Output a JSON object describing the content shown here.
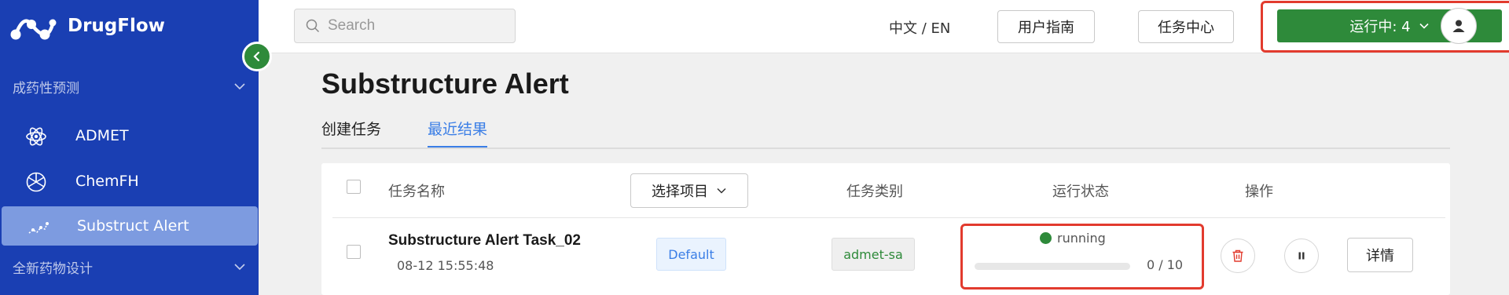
{
  "brand": {
    "name": "DrugFlow",
    "logo_icon": "drugflow-logo-icon"
  },
  "sidebar": {
    "groups": [
      {
        "label": "成药性预测",
        "expanded": true
      },
      {
        "label": "全新药物设计",
        "expanded": false
      }
    ],
    "items": [
      {
        "label": "ADMET",
        "icon": "atom-icon",
        "active": false
      },
      {
        "label": "ChemFH",
        "icon": "filter-wheel-icon",
        "active": false
      },
      {
        "label": "Substruct Alert",
        "icon": "substructure-icon",
        "active": true
      }
    ],
    "collapse_icon": "chevron-left-icon"
  },
  "topbar": {
    "search": {
      "placeholder": "Search",
      "value": ""
    },
    "lang_toggle": "中文 / EN",
    "user_guide": "用户指南",
    "task_center": "任务中心",
    "running_button": "运行中: 4",
    "highlight_color": "#e23b2e"
  },
  "main": {
    "title": "Substructure Alert",
    "tabs": [
      {
        "label": "创建任务",
        "active": false
      },
      {
        "label": "最近结果",
        "active": true
      }
    ],
    "table": {
      "headers": {
        "task_name": "任务名称",
        "select_project": "选择项目",
        "task_type": "任务类别",
        "status": "运行状态",
        "actions": "操作"
      },
      "rows": [
        {
          "name": "Substructure Alert Task_02",
          "time": "08-12 15:55:48",
          "project": "Default",
          "type": "admet-sa",
          "status": "running",
          "progress_done": 0,
          "progress_total": 10,
          "progress_text": "0 / 10",
          "detail_label": "详情"
        }
      ]
    }
  },
  "colors": {
    "sidebar_bg": "#1a3fb3",
    "accent_green": "#2e8a3a",
    "accent_blue": "#3a7ee6",
    "delete_red": "#e23b2e"
  }
}
